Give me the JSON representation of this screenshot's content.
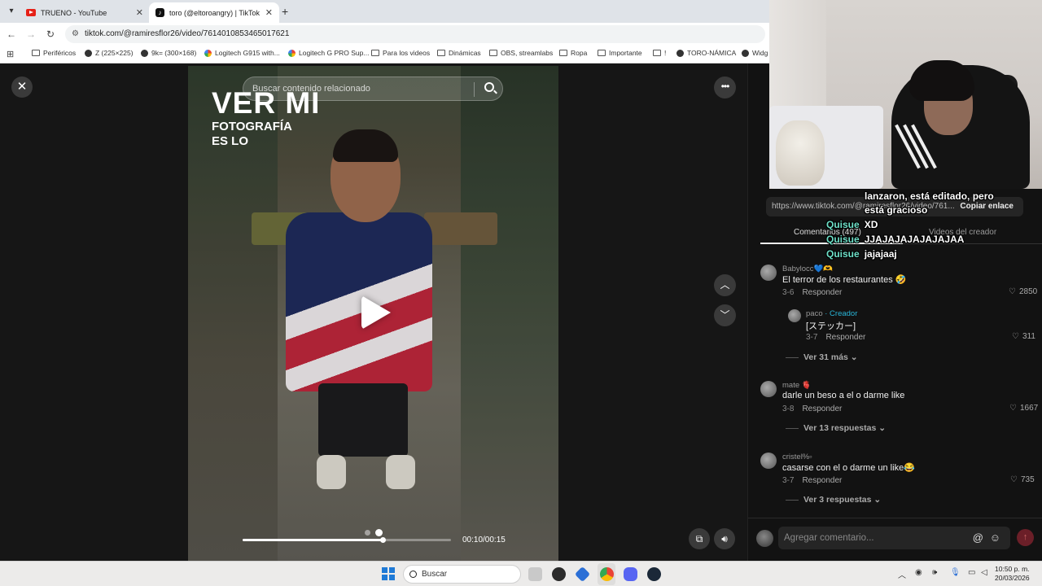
{
  "browser": {
    "tabs": [
      {
        "title": "TRUENO - YouTube",
        "favicon": "youtube-icon",
        "active": false
      },
      {
        "title": "toro (@eltoroangry) | TikTok",
        "favicon": "tiktok-icon",
        "active": true
      }
    ],
    "url": "tiktok.com/@ramiresflor26/video/7614010853465017621",
    "bookmarks": [
      {
        "label": "Periféricos",
        "icon": "folder-icon"
      },
      {
        "label": "Z (225×225)",
        "icon": "globe-icon"
      },
      {
        "label": "9k= (300×168)",
        "icon": "globe-icon"
      },
      {
        "label": "Logitech G915 with...",
        "icon": "google-icon"
      },
      {
        "label": "Logitech G PRO Sup...",
        "icon": "google-icon"
      },
      {
        "label": "Para los videos",
        "icon": "folder-icon"
      },
      {
        "label": "Dinámicas",
        "icon": "folder-icon"
      },
      {
        "label": "OBS, streamlabs",
        "icon": "folder-icon"
      },
      {
        "label": "Ropa",
        "icon": "folder-icon"
      },
      {
        "label": "Importante",
        "icon": "folder-icon"
      },
      {
        "label": "!",
        "icon": "folder-icon"
      },
      {
        "label": "TORO-NÁMICA",
        "icon": "globe-icon"
      },
      {
        "label": "Widg",
        "icon": "globe-icon"
      }
    ]
  },
  "video": {
    "search_placeholder": "Buscar contenido relacionado",
    "overlay_big": "VER MI",
    "overlay_line2": "FOTOGRAFÍA",
    "overlay_line3": "ES LO",
    "time": "00:10/00:15",
    "progress_fraction": 0.67,
    "slide_count": 2,
    "active_slide": 2
  },
  "side": {
    "link_text": "https://www.tiktok.com/@ramiresflor26/video/761...",
    "copy_label": "Copiar enlace",
    "tab_comments": "Comentarios (497)",
    "tab_creator": "Videos del creador",
    "comments": [
      {
        "user": "Babylocc💙🫶",
        "text": "El terror de los restaurantes 🤣",
        "date": "3-6",
        "reply": "Responder",
        "likes": "2850",
        "more": "Ver 31 más"
      },
      {
        "user": "paco",
        "creator": "· Creador",
        "text": "[ステッカー]",
        "date": "3-7",
        "reply": "Responder",
        "likes": "311"
      },
      {
        "user": "mate 🫀",
        "text": "darle un beso a el o darme like",
        "date": "3-8",
        "reply": "Responder",
        "likes": "1667",
        "more": "Ver 13 respuestas"
      },
      {
        "user": "cristel%▫",
        "text": "casarse con el o darme un like😂",
        "date": "3-7",
        "reply": "Responder",
        "likes": "735",
        "more": "Ver 3 respuestas"
      }
    ],
    "input_placeholder": "Agregar comentario..."
  },
  "chat": [
    {
      "user": "",
      "text": "lanzaron, está editado, pero"
    },
    {
      "user": "",
      "text": "está gracioso"
    },
    {
      "user": "Quisue",
      "text": "XD"
    },
    {
      "user": "Quisue",
      "text": "JJAJAJAJAJAJAJAA"
    },
    {
      "user": "Quisue",
      "text": "jajajaaj"
    }
  ],
  "taskbar": {
    "search_label": "Buscar",
    "time": "10:50 p. m.",
    "date": "20/03/2026"
  }
}
